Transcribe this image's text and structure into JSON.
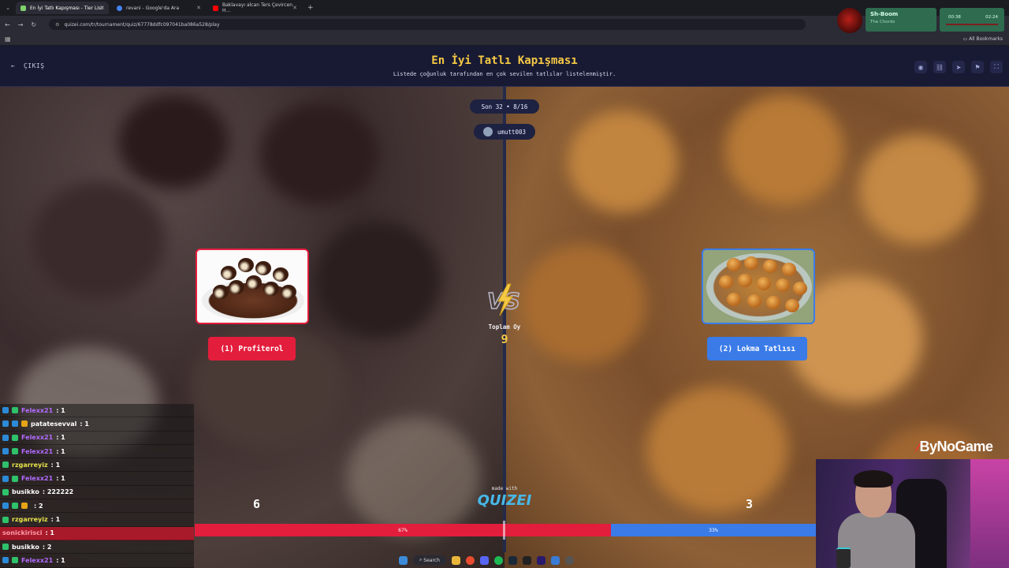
{
  "browser": {
    "tabs": [
      {
        "label": "En İyi Tatlı Kapışması - Tier List",
        "active": true,
        "color": "#7fd16b"
      },
      {
        "label": "revani - Google'da Ara",
        "active": false,
        "color": "#4285f4"
      },
      {
        "label": "Baklavayı alcan Ters Çevircen H...",
        "active": false,
        "color": "#ff0000"
      }
    ],
    "url": "quizei.com/tr/tournament/quiz/67778ddfc097041ba086a528/play",
    "bookmarks_label": "All Bookmarks"
  },
  "music": {
    "song": "Sh-Boom",
    "artist": "The Chords",
    "elapsed": "00:38",
    "total": "02:24"
  },
  "header": {
    "exit_label": "ÇIKIŞ",
    "title": "En İyi Tatlı Kapışması",
    "subtitle": "Listede çoğunluk tarafından en çok sevilen tatlılar listelenmiştir.",
    "icons": [
      "eye-icon",
      "link-icon",
      "send-icon",
      "flag-icon",
      "fullscreen-icon"
    ]
  },
  "round": {
    "label": "Son 32 • 8/16",
    "creator": "umutt003"
  },
  "options": [
    {
      "label": "(1) Profiterol",
      "votes": "6",
      "percent": "67%",
      "percent_value": 67,
      "color": "#e31d3c"
    },
    {
      "label": "(2) Lokma Tatlısı",
      "votes": "3",
      "percent": "33%",
      "percent_value": 33,
      "color": "#3a7be8"
    }
  ],
  "total": {
    "label": "Toplam Oy",
    "value": "9"
  },
  "brand": {
    "made_with": "made with",
    "logo": "QUIZEI",
    "overlay": "ByNoGame"
  },
  "chat": [
    {
      "user": "Felexx21",
      "text": ": 1",
      "color": "#b36bff",
      "badges": [
        "b1",
        "b2"
      ],
      "highlight": false
    },
    {
      "user": "patatesevval",
      "text": ": 1",
      "color": "#ffffff",
      "badges": [
        "b1",
        "b1",
        "b3"
      ],
      "highlight": false
    },
    {
      "user": "Felexx21",
      "text": ": 1",
      "color": "#b36bff",
      "badges": [
        "b1",
        "b2"
      ],
      "highlight": false
    },
    {
      "user": "Felexx21",
      "text": ": 1",
      "color": "#b36bff",
      "badges": [
        "b1",
        "b2"
      ],
      "highlight": false
    },
    {
      "user": "rzgarreyiz",
      "text": ": 1",
      "color": "#e6e24a",
      "badges": [
        "b2"
      ],
      "highlight": false
    },
    {
      "user": "Felexx21",
      "text": ": 1",
      "color": "#b36bff",
      "badges": [
        "b1",
        "b2"
      ],
      "highlight": false
    },
    {
      "user": "busikko",
      "text": ": 222222",
      "color": "#ffffff",
      "badges": [
        "b2"
      ],
      "highlight": false
    },
    {
      "user": "",
      "text": ": 2",
      "color": "#ff2d2d",
      "badges": [
        "b1",
        "b2",
        "b3"
      ],
      "highlight": false
    },
    {
      "user": "rzgarreyiz",
      "text": ": 1",
      "color": "#e6e24a",
      "badges": [
        "b2"
      ],
      "highlight": false
    },
    {
      "user": "sonickirisci",
      "text": ": 1",
      "color": "#ff9aa8",
      "badges": [],
      "highlight": true
    },
    {
      "user": "busikko",
      "text": ": 2",
      "color": "#ffffff",
      "badges": [
        "b2"
      ],
      "highlight": false
    },
    {
      "user": "Felexx21",
      "text": ": 1",
      "color": "#b36bff",
      "badges": [
        "b1",
        "b2"
      ],
      "highlight": false
    }
  ],
  "taskbar": {
    "search_label": "Search"
  }
}
